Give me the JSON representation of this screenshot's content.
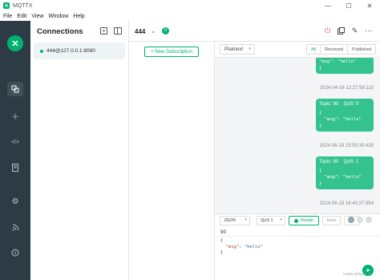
{
  "window": {
    "title": "MQTTX",
    "controls": {
      "minimize": "—",
      "maximize": "☐",
      "close": "✕"
    }
  },
  "menu": [
    "File",
    "Edit",
    "View",
    "Window",
    "Help"
  ],
  "nav": {
    "logo": "✕",
    "icons": [
      "copy-icon",
      "plus-icon",
      "code-icon",
      "script-icon",
      "gear-icon",
      "rss-icon",
      "info-icon"
    ]
  },
  "connections": {
    "title": "Connections",
    "items": [
      {
        "label": "444@127.0.0.1:8080",
        "status_color": "#00b173"
      }
    ]
  },
  "tab": {
    "name": "444",
    "badge": "0"
  },
  "topics": {
    "new_subscription": "+  New Subscription"
  },
  "messages": {
    "format": "Plaintext",
    "filters": [
      "All",
      "Received",
      "Published"
    ],
    "active_filter": "All",
    "items": [
      {
        "topic_line": "",
        "payload_lines": [
          "\"msg\": \"hello\"",
          "}"
        ],
        "time": "2024-04-16 12:27:58:110"
      },
      {
        "topic_line": "Topic: 90    QoS: 0",
        "payload_lines": [
          "{",
          "  \"msg\": \"hello\"",
          "}"
        ],
        "time": "2024-06-19 15:50:30:428"
      },
      {
        "topic_line": "Topic: 90    QoS: 1",
        "payload_lines": [
          "{",
          "  \"msg\": \"hello\"",
          "}"
        ],
        "time": "2024-06-19 16:40:37:954"
      }
    ]
  },
  "publish": {
    "payload_format": "JSON",
    "qos": "QoS 1",
    "retain_label": "Retain",
    "meta_label": "Meta",
    "topic": "90",
    "payload": {
      "open": "{",
      "key": "\"msg\"",
      "sep": ": ",
      "value": "\"hello\"",
      "close": "}"
    }
  },
  "watermark": "CSDN @Ryan_h",
  "colors": {
    "accent": "#00b173",
    "bubble": "#34c38f",
    "nav_bg": "#2d3b44"
  }
}
